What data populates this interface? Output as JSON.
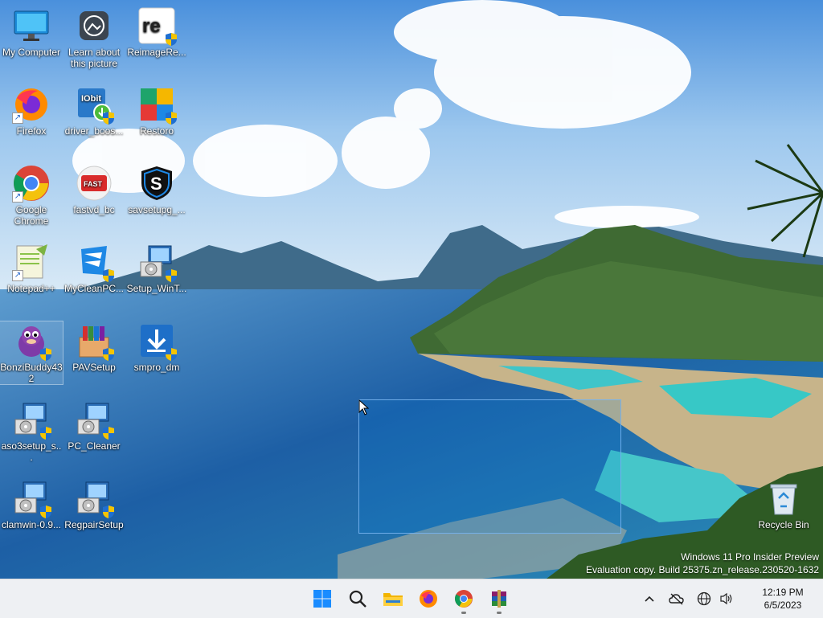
{
  "desktop_icons": [
    {
      "label": "My Computer",
      "name": "icon-my-computer",
      "icon": "monitor-icon"
    },
    {
      "label": "Learn about this picture",
      "name": "icon-learn-about-picture",
      "icon": "camera-icon"
    },
    {
      "label": "ReimageRe...",
      "name": "icon-reimage",
      "icon": "reimage-icon"
    },
    {
      "label": "Firefox",
      "name": "icon-firefox",
      "icon": "firefox-icon"
    },
    {
      "label": "driver_boos...",
      "name": "icon-driver-booster",
      "icon": "iobit-icon"
    },
    {
      "label": "Restoro",
      "name": "icon-restoro",
      "icon": "restoro-icon"
    },
    {
      "label": "Google Chrome",
      "name": "icon-google-chrome",
      "icon": "chrome-icon"
    },
    {
      "label": "fastvd_bc",
      "name": "icon-fastvd",
      "icon": "fast-video-icon"
    },
    {
      "label": "savsetupg_...",
      "name": "icon-savsetup",
      "icon": "shield-s-icon"
    },
    {
      "label": "Notepad++",
      "name": "icon-notepadpp",
      "icon": "notepad-icon"
    },
    {
      "label": "MyCleanPC...",
      "name": "icon-mycleanpc",
      "icon": "mycleanpc-icon"
    },
    {
      "label": "Setup_WinT...",
      "name": "icon-setup-wint",
      "icon": "installer-icon"
    },
    {
      "label": "BonziBuddy432",
      "name": "icon-bonzibuddy",
      "icon": "bonzi-icon"
    },
    {
      "label": "PAVSetup",
      "name": "icon-pavsetup",
      "icon": "box-icon"
    },
    {
      "label": "smpro_dm",
      "name": "icon-smpro",
      "icon": "download-icon"
    },
    {
      "label": "aso3setup_s...",
      "name": "icon-aso3setup",
      "icon": "installer-icon"
    },
    {
      "label": "PC_Cleaner",
      "name": "icon-pc-cleaner",
      "icon": "installer-icon"
    },
    {
      "label": "clamwin-0.9...",
      "name": "icon-clamwin",
      "icon": "installer-icon"
    },
    {
      "label": "RegpairSetup",
      "name": "icon-regpair",
      "icon": "installer-icon"
    },
    {
      "label": "Recycle Bin",
      "name": "icon-recycle-bin",
      "icon": "recycle-bin-icon"
    }
  ],
  "watermark": {
    "line1": "Windows 11 Pro Insider Preview",
    "line2": "Evaluation copy. Build 25375.zn_release.230520-1632"
  },
  "taskbar": {
    "apps": [
      {
        "name": "start-button",
        "icon": "windows-logo-icon",
        "running": false
      },
      {
        "name": "search-button",
        "icon": "search-icon",
        "running": false
      },
      {
        "name": "file-explorer-button",
        "icon": "folder-icon",
        "running": false
      },
      {
        "name": "firefox-taskbar-button",
        "icon": "firefox-icon",
        "running": false
      },
      {
        "name": "chrome-taskbar-button",
        "icon": "chrome-icon",
        "running": true
      },
      {
        "name": "winrar-taskbar-button",
        "icon": "winrar-icon",
        "running": true
      }
    ],
    "clock": {
      "time": "12:19 PM",
      "date": "6/5/2023"
    }
  },
  "colors": {
    "accent": "#0078d4",
    "taskbar": "#eef0f3"
  }
}
